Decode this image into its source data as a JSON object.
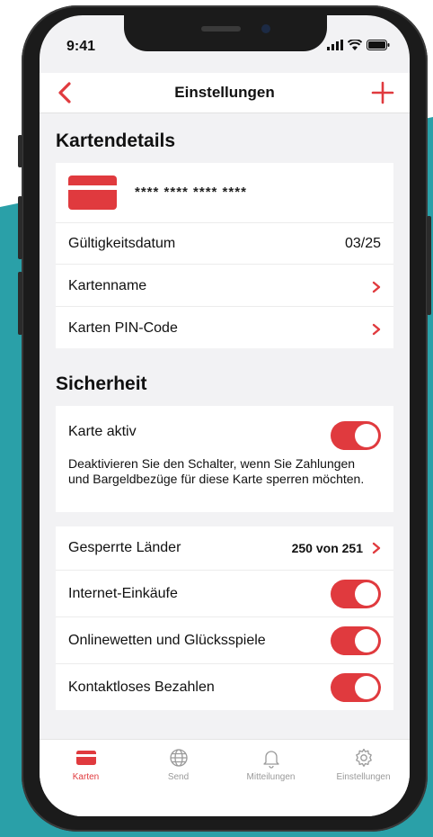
{
  "status_bar": {
    "time": "9:41"
  },
  "nav": {
    "title": "Einstellungen"
  },
  "card_details": {
    "section_title": "Kartendetails",
    "card_number": "**** **** **** ****",
    "expiry_label": "Gültigkeitsdatum",
    "expiry_value": "03/25",
    "card_name_label": "Kartenname",
    "pin_label": "Karten PIN-Code"
  },
  "security": {
    "section_title": "Sicherheit",
    "card_active_label": "Karte aktiv",
    "card_active_on": true,
    "card_active_desc": "Deaktivieren Sie den Schalter, wenn Sie Zahlungen und Bargeldbezüge für diese Karte sperren möchten.",
    "blocked_countries_label": "Gesperrte Länder",
    "blocked_countries_value": "250 von 251",
    "internet_label": "Internet-Einkäufe",
    "internet_on": true,
    "gambling_label": "Onlinewetten und Glücksspiele",
    "gambling_on": true,
    "contactless_label": "Kontaktloses Bezahlen",
    "contactless_on": true
  },
  "tabs": [
    {
      "label": "Karten",
      "active": true
    },
    {
      "label": "Send",
      "active": false
    },
    {
      "label": "Mitteilungen",
      "active": false
    },
    {
      "label": "Einstellungen",
      "active": false
    }
  ],
  "colors": {
    "accent": "#e03a3e",
    "background": "#2aa0a8"
  }
}
